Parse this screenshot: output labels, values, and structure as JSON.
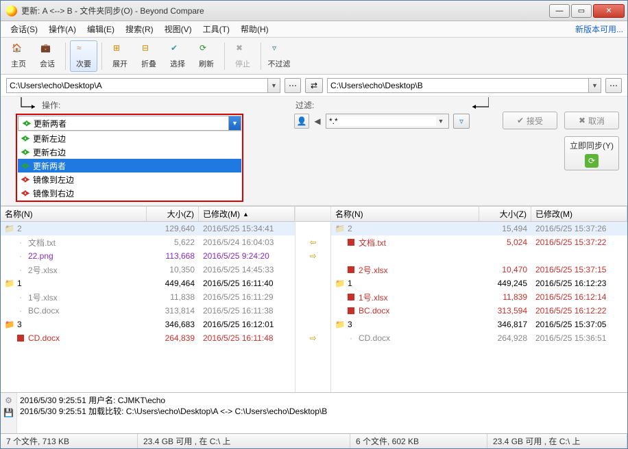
{
  "title": "更新: A <--> B - 文件夹同步(O) - Beyond Compare",
  "newVersion": "新版本可用...",
  "menus": [
    {
      "label": "会话(S)"
    },
    {
      "label": "操作(A)"
    },
    {
      "label": "编辑(E)"
    },
    {
      "label": "搜索(R)"
    },
    {
      "label": "视图(V)"
    },
    {
      "label": "工具(T)"
    },
    {
      "label": "帮助(H)"
    }
  ],
  "toolbar": [
    {
      "name": "home",
      "label": "主页",
      "disabled": false
    },
    {
      "name": "session",
      "label": "会话",
      "disabled": false
    },
    {
      "name": "secondary",
      "label": "次要",
      "disabled": false,
      "active": true
    },
    {
      "name": "expand",
      "label": "展开",
      "disabled": false
    },
    {
      "name": "collapse",
      "label": "折叠",
      "disabled": false
    },
    {
      "name": "select",
      "label": "选择",
      "disabled": false
    },
    {
      "name": "refresh",
      "label": "刷新",
      "disabled": false
    },
    {
      "name": "stop",
      "label": "停止",
      "disabled": true
    },
    {
      "name": "nofilter",
      "label": "不过滤",
      "disabled": false
    }
  ],
  "paths": {
    "left": "C:\\Users\\echo\\Desktop\\A",
    "right": "C:\\Users\\echo\\Desktop\\B"
  },
  "ops": {
    "label": "操作:",
    "selected": "更新两者",
    "options": [
      {
        "text": "更新左边",
        "kind": "green"
      },
      {
        "text": "更新右边",
        "kind": "green"
      },
      {
        "text": "更新两者",
        "kind": "green",
        "selected": true
      },
      {
        "text": "镜像到左边",
        "kind": "red"
      },
      {
        "text": "镜像到右边",
        "kind": "red"
      }
    ]
  },
  "filter": {
    "label": "过滤:",
    "value": "*.*"
  },
  "buttons": {
    "accept": "接受",
    "cancel": "取消",
    "syncNow": "立即同步(Y)"
  },
  "columns": {
    "name": "名称(N)",
    "size": "大小(Z)",
    "modified": "已修改(M)"
  },
  "left": [
    {
      "kind": "folder",
      "color": "gray",
      "name": "2",
      "size": "129,640",
      "date": "2016/5/25 15:34:41",
      "sel": true
    },
    {
      "kind": "file",
      "color": "gray",
      "indent": 1,
      "name": "文档.txt",
      "size": "5,622",
      "date": "2016/5/24 16:04:03"
    },
    {
      "kind": "file",
      "color": "purple",
      "indent": 1,
      "name": "22.png",
      "size": "113,668",
      "date": "2016/5/25 9:24:20"
    },
    {
      "kind": "file",
      "color": "gray",
      "indent": 1,
      "name": "2号.xlsx",
      "size": "10,350",
      "date": "2016/5/25 14:45:33"
    },
    {
      "kind": "folder",
      "color": "folder",
      "name": "1",
      "size": "449,464",
      "date": "2016/5/25 16:11:40"
    },
    {
      "kind": "file",
      "color": "gray",
      "indent": 1,
      "name": "1号.xlsx",
      "size": "11,838",
      "date": "2016/5/25 16:11:29"
    },
    {
      "kind": "file",
      "color": "gray",
      "indent": 1,
      "name": "BC.docx",
      "size": "313,814",
      "date": "2016/5/25 16:11:38"
    },
    {
      "kind": "folder",
      "color": "folder-red",
      "name": "3",
      "size": "346,683",
      "date": "2016/5/25 16:12:01"
    },
    {
      "kind": "file",
      "color": "red",
      "indent": 1,
      "icon": "sqred",
      "name": "CD.docx",
      "size": "264,839",
      "date": "2016/5/25 16:11:48"
    }
  ],
  "mid": [
    "",
    "⇦",
    "⇨",
    "",
    "",
    "",
    "",
    "",
    "⇨"
  ],
  "right": [
    {
      "kind": "folder",
      "color": "gray",
      "name": "2",
      "size": "15,494",
      "date": "2016/5/25 15:37:26",
      "sel": true
    },
    {
      "kind": "file",
      "color": "red",
      "indent": 1,
      "icon": "sqred",
      "name": "文档.txt",
      "size": "5,024",
      "date": "2016/5/25 15:37:22"
    },
    {
      "kind": "blank"
    },
    {
      "kind": "file",
      "color": "red",
      "indent": 1,
      "icon": "sqred",
      "name": "2号.xlsx",
      "size": "10,470",
      "date": "2016/5/25 15:37:15"
    },
    {
      "kind": "folder",
      "color": "folder",
      "name": "1",
      "size": "449,245",
      "date": "2016/5/25 16:12:23"
    },
    {
      "kind": "file",
      "color": "red",
      "indent": 1,
      "icon": "sqred",
      "name": "1号.xlsx",
      "size": "11,839",
      "date": "2016/5/25 16:12:14"
    },
    {
      "kind": "file",
      "color": "red",
      "indent": 1,
      "icon": "sqred",
      "name": "BC.docx",
      "size": "313,594",
      "date": "2016/5/25 16:12:22"
    },
    {
      "kind": "folder",
      "color": "folder",
      "name": "3",
      "size": "346,817",
      "date": "2016/5/25 15:37:05"
    },
    {
      "kind": "file",
      "color": "gray",
      "indent": 1,
      "name": "CD.docx",
      "size": "264,928",
      "date": "2016/5/25 15:36:51"
    }
  ],
  "log": [
    "2016/5/30 9:25:51  用户名: CJMKT\\echo",
    "2016/5/30 9:25:51  加载比较: C:\\Users\\echo\\Desktop\\A <-> C:\\Users\\echo\\Desktop\\B"
  ],
  "status": {
    "s1": "7 个文件, 713 KB",
    "s2": "23.4 GB 可用 , 在 C:\\ 上",
    "s3": "6 个文件, 602 KB",
    "s4": "23.4 GB 可用 , 在 C:\\ 上"
  }
}
